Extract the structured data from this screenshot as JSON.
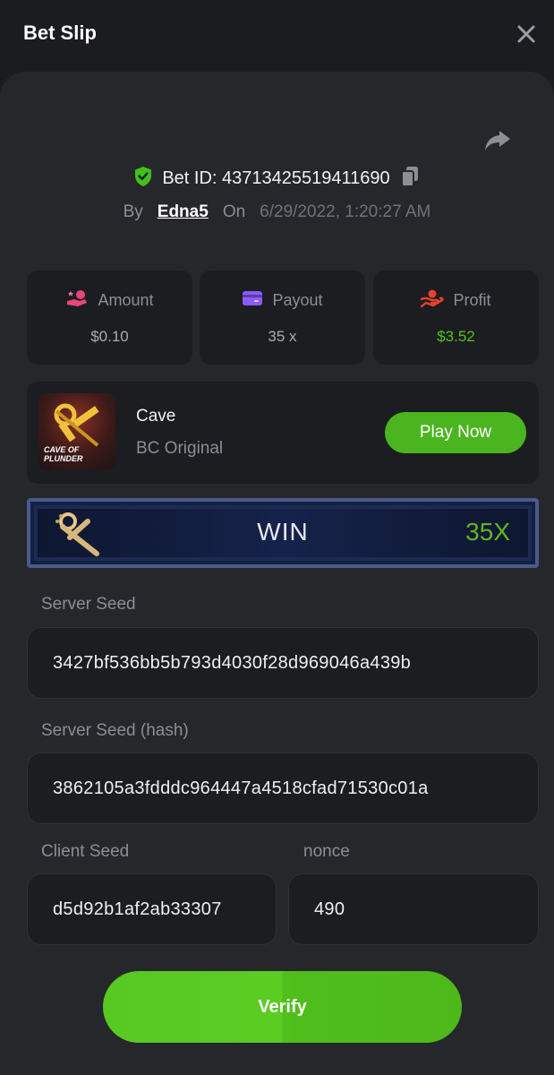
{
  "header": {
    "title": "Bet Slip",
    "close_icon": "close-icon"
  },
  "bet": {
    "id_label": "Bet ID:",
    "id_value": "43713425519411690",
    "id_full": "Bet ID: 43713425519411690",
    "by_label": "By",
    "username": "Edna5",
    "on_label": "On",
    "date": "6/29/2022, 1:20:27 AM"
  },
  "stats": {
    "amount": {
      "label": "Amount",
      "value": "$0.10",
      "icon": "coin-hand-icon"
    },
    "payout": {
      "label": "Payout",
      "value": "35 x",
      "icon": "wallet-icon"
    },
    "profit": {
      "label": "Profit",
      "value": "$3.52",
      "icon": "profit-hand-icon"
    }
  },
  "game": {
    "name": "Cave",
    "provider": "BC Original",
    "thumb_text": "CAVE OF PLUNDER",
    "play_label": "Play Now"
  },
  "result": {
    "label": "WIN",
    "multiplier": "35X"
  },
  "seeds": {
    "server_seed_label": "Server Seed",
    "server_seed": "3427bf536bb5b793d4030f28d969046a439b",
    "server_hash_label": "Server Seed (hash)",
    "server_hash": "3862105a3fdddc964447a4518cfad71530c01a",
    "client_seed_label": "Client Seed",
    "client_seed": "d5d92b1af2ab33307",
    "nonce_label": "nonce",
    "nonce": "490"
  },
  "verify_label": "Verify",
  "colors": {
    "accent_green": "#4ab51f",
    "profit_green": "#4ec61c",
    "background": "#1b1c1f",
    "panel": "#26272b",
    "card": "#1c1d20"
  }
}
